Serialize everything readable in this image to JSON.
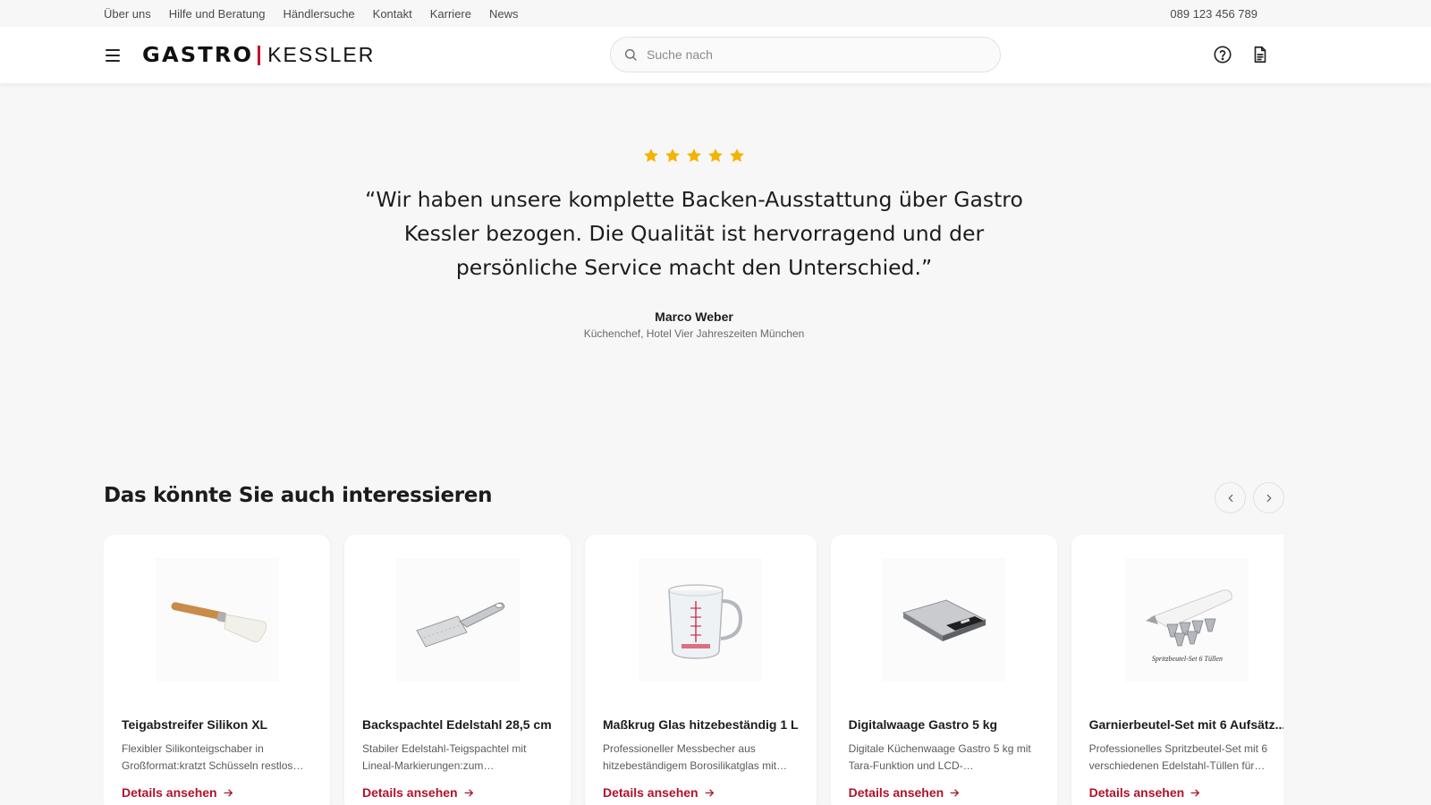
{
  "topbar": {
    "links": [
      "Über uns",
      "Hilfe und Beratung",
      "Händlersuche",
      "Kontakt",
      "Karriere",
      "News"
    ],
    "phone": "089 123 456 789"
  },
  "header": {
    "logo_left": "GASTRO",
    "logo_right": "KESSLER",
    "search_placeholder": "Suche nach",
    "icons": [
      "help-icon",
      "document-icon"
    ]
  },
  "testimonial": {
    "rating": 5,
    "quote": "“Wir haben unsere komplette Backen-Ausstattung über Gastro Kessler bezogen. Die Qualität ist hervorragend und der persönliche Service macht den Unterschied.”",
    "author": "Marco Weber",
    "role": "Küchenchef, Hotel Vier Jahreszeiten München"
  },
  "recommendations": {
    "title": "Das könnte Sie auch interessieren",
    "products": [
      {
        "name": "Teigabstreifer Silikon XL",
        "description": "Flexibler Silikonteigschaber in Großformat:kratzt Schüsseln restlos…",
        "link": "Details ansehen",
        "image_icon": "spatula-icon"
      },
      {
        "name": "Backspachtel Edelstahl 28,5 cm",
        "description": "Stabiler Edelstahl-Teigspachtel mit Lineal-Markierungen:zum Portionieren…",
        "link": "Details ansehen",
        "image_icon": "dough-scraper-icon"
      },
      {
        "name": "Maßkrug Glas hitzebeständig 1 L",
        "description": "Professioneller Messbecher aus hitzebeständigem Borosilikatglas mit…",
        "link": "Details ansehen",
        "image_icon": "measuring-jug-icon"
      },
      {
        "name": "Digitalwaage Gastro 5 kg",
        "description": "Digitale Küchenwaage Gastro 5 kg mit Tara-Funktion und LCD-Display:präzis…",
        "link": "Details ansehen",
        "image_icon": "kitchen-scale-icon"
      },
      {
        "name": "Garnierbeutel-Set mit 6 Aufsätz...",
        "description": "Professionelles Spritzbeutel-Set mit 6 verschiedenen Edelstahl-Tüllen für…",
        "link": "Details ansehen",
        "image_icon": "piping-bag-icon",
        "image_caption": "Spritzbeutel-Set 6 Tüllen"
      }
    ]
  },
  "colors": {
    "accent": "#b0122b",
    "logo_bar": "#c8102e",
    "star": "#f5b301",
    "background": "#f7f7f8"
  }
}
